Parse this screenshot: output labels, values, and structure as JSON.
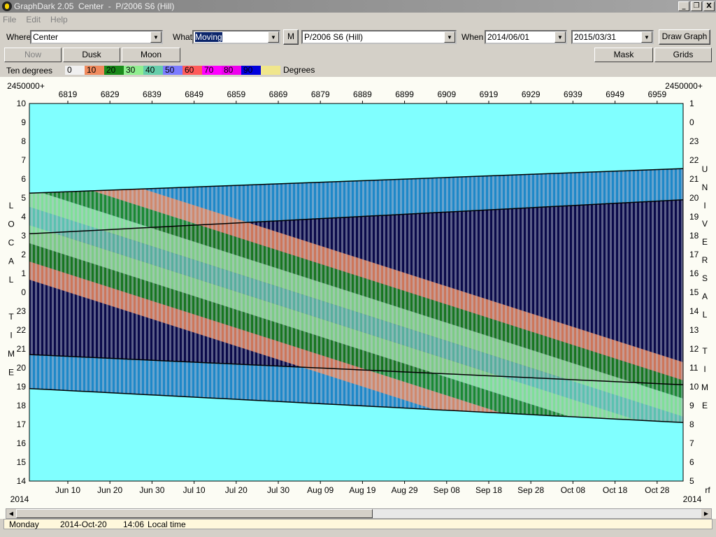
{
  "window": {
    "title": "GraphDark 2.05  Center  -  P/2006 S6 (Hill)",
    "controls": [
      "_",
      "❐",
      "X"
    ]
  },
  "menu": [
    "File",
    "Edit",
    "Help"
  ],
  "toolbar": {
    "where_label": "Where",
    "where_value": "Center",
    "what_label": "What",
    "what_value": "Moving",
    "m_label": "M",
    "object_value": "P/2006 S6 (Hill)",
    "when_label": "When",
    "start_date": "2014/06/01",
    "end_date": "2015/03/31",
    "draw_label": "Draw Graph"
  },
  "toolbar2": {
    "now_label": "Now",
    "dusk_label": "Dusk",
    "moon_label": "Moon",
    "mask_label": "Mask",
    "grids_label": "Grids"
  },
  "legend": {
    "title": "Ten degrees",
    "unit": "Degrees",
    "bands": [
      {
        "label": "0",
        "color": "#f0f0f0"
      },
      {
        "label": "10",
        "color": "#f08a5d"
      },
      {
        "label": "20",
        "color": "#1a8a1a"
      },
      {
        "label": "30",
        "color": "#90ee90"
      },
      {
        "label": "40",
        "color": "#66cdaa"
      },
      {
        "label": "50",
        "color": "#7b7bff"
      },
      {
        "label": "60",
        "color": "#ff5a5a"
      },
      {
        "label": "70",
        "color": "#ff00ff"
      },
      {
        "label": "80",
        "color": "#ee00ee"
      },
      {
        "label": "90",
        "color": "#0000dd"
      },
      {
        "label": "",
        "color": "#f0e68c"
      }
    ]
  },
  "chart_data": {
    "type": "area",
    "jd_prefix": "2450000+",
    "jd_ticks": [
      "6819",
      "6829",
      "6839",
      "6849",
      "6859",
      "6869",
      "6879",
      "6889",
      "6899",
      "6909",
      "6919",
      "6929",
      "6939",
      "6949",
      "6959"
    ],
    "x_ticks": [
      "Jun 10",
      "Jun 20",
      "Jun 30",
      "Jul 10",
      "Jul 20",
      "Jul 30",
      "Aug 09",
      "Aug 19",
      "Aug 29",
      "Sep 08",
      "Sep 18",
      "Sep 28",
      "Oct 08",
      "Oct 18",
      "Oct 28"
    ],
    "year_left": "2014",
    "year_right": "2014",
    "corner_right": "rf",
    "left_axis": [
      "10",
      "9",
      "8",
      "7",
      "6",
      "5",
      "4",
      "3",
      "2",
      "1",
      "0",
      "23",
      "22",
      "21",
      "20",
      "19",
      "18",
      "17",
      "16",
      "15",
      "14"
    ],
    "right_axis": [
      "1",
      "0",
      "23",
      "22",
      "21",
      "20",
      "19",
      "18",
      "17",
      "16",
      "15",
      "14",
      "13",
      "12",
      "11",
      "10",
      "9",
      "8",
      "7",
      "6",
      "5"
    ],
    "left_label": [
      "L",
      "O",
      "C",
      "A",
      "L",
      "",
      "T",
      "I",
      "M",
      "E"
    ],
    "right_label": [
      "U",
      "N",
      "I",
      "V",
      "E",
      "R",
      "S",
      "A",
      "L",
      "",
      "T",
      "I",
      "M",
      "E"
    ],
    "colors": {
      "day": "#80ffff",
      "twilight": "#1e88c8",
      "night": "#0a0a4a",
      "object_bars": "#c0c8d8"
    }
  },
  "status": {
    "day": "Monday",
    "date": "2014-Oct-20",
    "time": "14:06",
    "mode": "Local time"
  }
}
